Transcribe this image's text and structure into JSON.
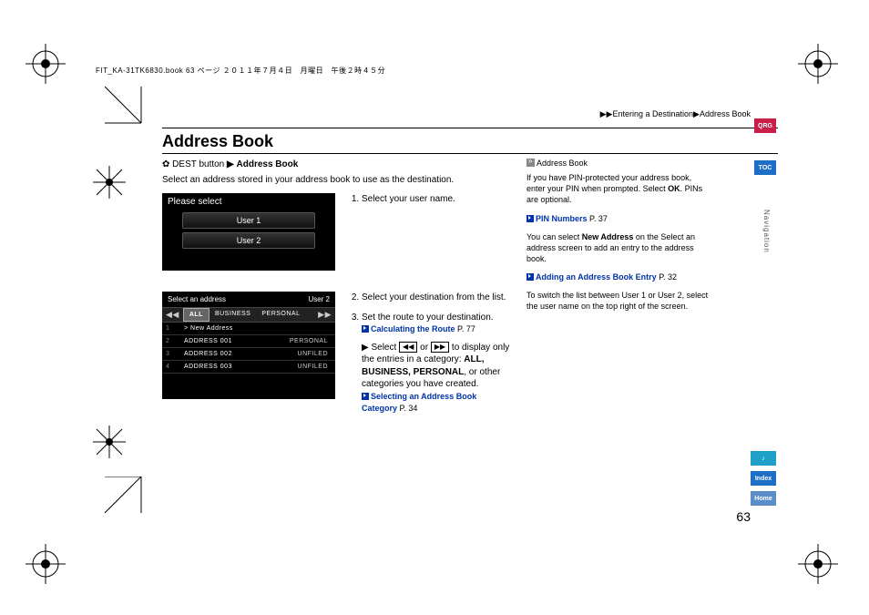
{
  "header_line": "FIT_KA-31TK6830.book  63 ページ  ２０１１年７月４日　月曜日　午後２時４５分",
  "breadcrumb": "▶▶Entering a Destination▶Address Book",
  "section_title": "Address Book",
  "nav": {
    "pre": "DEST button",
    "arrow": "▶",
    "target": "Address Book"
  },
  "intro": "Select an address stored in your address book to use as the destination.",
  "screen1": {
    "title": "Please select",
    "users": [
      "User 1",
      "User 2"
    ]
  },
  "screen2": {
    "title": "Select an address",
    "user": "User 2",
    "tabs": {
      "left": "◀◀",
      "all": "ALL",
      "business": "BUSINESS",
      "personal": "PERSONAL",
      "right": "▶▶"
    },
    "rows": [
      {
        "n": "1",
        "label": "> New Address",
        "cat": ""
      },
      {
        "n": "2",
        "label": "ADDRESS 001",
        "cat": "PERSONAL"
      },
      {
        "n": "3",
        "label": "ADDRESS 002",
        "cat": "UNFILED"
      },
      {
        "n": "4",
        "label": "ADDRESS 003",
        "cat": "UNFILED"
      }
    ]
  },
  "steps": {
    "s1": "Select your user name.",
    "s2": "Select your destination from the list.",
    "s3": "Set the route to your destination.",
    "link_calc": "Calculating the Route",
    "link_calc_p": "P. 77",
    "s3b_pre": "Select",
    "s3b_mid": "or",
    "s3b_post": "to display only the entries in a category: ",
    "s3b_cats": "ALL, BUSINESS, PERSONAL",
    "s3b_tail": ", or other categories you have created.",
    "link_cat": "Selecting an Address Book Category",
    "link_cat_p": "P. 34",
    "btn_prev": "◀◀",
    "btn_next": "▶▶"
  },
  "sidebar": {
    "head": "Address Book",
    "p1a": "If you have PIN-protected your address book, enter your PIN when prompted. Select ",
    "p1b": "OK",
    "p1c": ". PINs are optional.",
    "link_pin": "PIN Numbers",
    "link_pin_p": "P. 37",
    "p2a": "You can select ",
    "p2b": "New Address",
    "p2c": " on the Select an address screen to add an entry to the address book.",
    "link_add": "Adding an Address Book Entry",
    "link_add_p": "P. 32",
    "p3": "To switch the list between User 1 or User 2, select the user name on the top right of the screen."
  },
  "tabs": {
    "qrg": "QRG",
    "toc": "TOC",
    "nav": "Navigation",
    "idx": "Index",
    "home": "Home"
  },
  "page_number": "63"
}
